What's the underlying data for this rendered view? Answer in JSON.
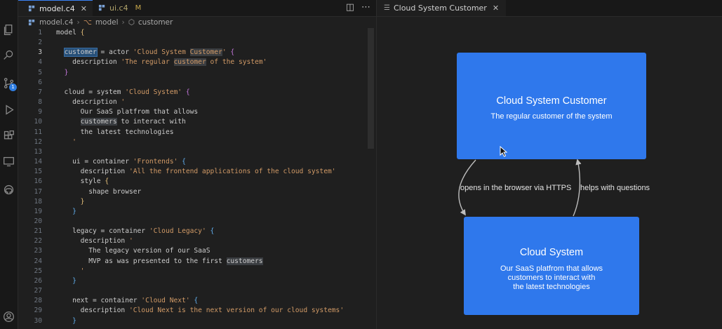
{
  "tabs": [
    {
      "label": "model.c4",
      "active": true
    },
    {
      "label": "ui.c4",
      "status": "M"
    }
  ],
  "breadcrumb": [
    "model.c4",
    "model",
    "customer"
  ],
  "code_lines": [
    {
      "n": "1",
      "text": "model {"
    },
    {
      "n": "2",
      "text": ""
    },
    {
      "n": "3",
      "text": "  customer = actor 'Cloud System Customer' {"
    },
    {
      "n": "4",
      "text": "    description 'The regular customer of the system'"
    },
    {
      "n": "5",
      "text": "  }"
    },
    {
      "n": "6",
      "text": ""
    },
    {
      "n": "7",
      "text": "  cloud = system 'Cloud System' {"
    },
    {
      "n": "8",
      "text": "    description '"
    },
    {
      "n": "9",
      "text": "      Our SaaS platfrom that allows"
    },
    {
      "n": "10",
      "text": "      customers to interact with"
    },
    {
      "n": "11",
      "text": "      the latest technologies"
    },
    {
      "n": "12",
      "text": "    '"
    },
    {
      "n": "13",
      "text": ""
    },
    {
      "n": "14",
      "text": "    ui = container 'Frontends' {"
    },
    {
      "n": "15",
      "text": "      description 'All the frontend applications of the cloud system'"
    },
    {
      "n": "16",
      "text": "      style {"
    },
    {
      "n": "17",
      "text": "        shape browser"
    },
    {
      "n": "18",
      "text": "      }"
    },
    {
      "n": "19",
      "text": "    }"
    },
    {
      "n": "20",
      "text": ""
    },
    {
      "n": "21",
      "text": "    legacy = container 'Cloud Legacy' {"
    },
    {
      "n": "22",
      "text": "      description '"
    },
    {
      "n": "23",
      "text": "        The legacy version of our SaaS"
    },
    {
      "n": "24",
      "text": "        MVP as was presented to the first customers"
    },
    {
      "n": "25",
      "text": "      '"
    },
    {
      "n": "26",
      "text": "    }"
    },
    {
      "n": "27",
      "text": ""
    },
    {
      "n": "28",
      "text": "    next = container 'Cloud Next' {"
    },
    {
      "n": "29",
      "text": "      description 'Cloud Next is the next version of our cloud systems'"
    },
    {
      "n": "30",
      "text": "    }"
    }
  ],
  "active_line": "3",
  "preview": {
    "tab_label": "Cloud System Customer",
    "customer": {
      "title": "Cloud System Customer",
      "description": "The regular customer of the system"
    },
    "system": {
      "title": "Cloud System",
      "description_lines": [
        "Our SaaS platfrom that allows",
        "customers to interact with",
        "the latest technologies"
      ]
    },
    "edges": [
      {
        "label": "opens in the browser via HTTPS"
      },
      {
        "label": "helps with questions"
      }
    ],
    "node_color": "#2f78ec"
  }
}
